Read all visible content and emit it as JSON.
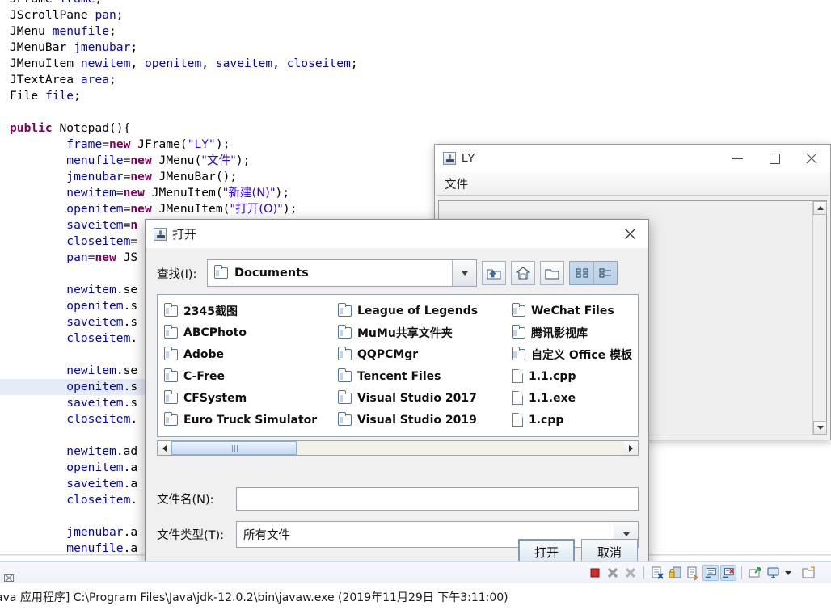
{
  "editor": {
    "code_lines": [
      {
        "hl": false,
        "tokens": [
          {
            "t": "JFrame ",
            "c": ""
          },
          {
            "t": "frame",
            "c": "fld"
          },
          {
            "t": ";",
            "c": ""
          }
        ]
      },
      {
        "hl": false,
        "tokens": [
          {
            "t": "JScrollPane ",
            "c": ""
          },
          {
            "t": "pan",
            "c": "fld"
          },
          {
            "t": ";",
            "c": ""
          }
        ]
      },
      {
        "hl": false,
        "tokens": [
          {
            "t": "JMenu ",
            "c": ""
          },
          {
            "t": "menufile",
            "c": "fld"
          },
          {
            "t": ";",
            "c": ""
          }
        ]
      },
      {
        "hl": false,
        "tokens": [
          {
            "t": "JMenuBar ",
            "c": ""
          },
          {
            "t": "jmenubar",
            "c": "fld"
          },
          {
            "t": ";",
            "c": ""
          }
        ]
      },
      {
        "hl": false,
        "tokens": [
          {
            "t": "JMenuItem ",
            "c": ""
          },
          {
            "t": "newitem",
            "c": "fld"
          },
          {
            "t": ", ",
            "c": ""
          },
          {
            "t": "openitem",
            "c": "fld"
          },
          {
            "t": ", ",
            "c": ""
          },
          {
            "t": "saveitem",
            "c": "fld"
          },
          {
            "t": ", ",
            "c": ""
          },
          {
            "t": "closeitem",
            "c": "fld"
          },
          {
            "t": ";",
            "c": ""
          }
        ]
      },
      {
        "hl": false,
        "tokens": [
          {
            "t": "JTextArea ",
            "c": ""
          },
          {
            "t": "area",
            "c": "fld"
          },
          {
            "t": ";",
            "c": ""
          }
        ]
      },
      {
        "hl": false,
        "tokens": [
          {
            "t": "File ",
            "c": ""
          },
          {
            "t": "file",
            "c": "fld"
          },
          {
            "t": ";",
            "c": ""
          }
        ]
      },
      {
        "hl": false,
        "tokens": []
      },
      {
        "hl": false,
        "tokens": [
          {
            "t": "public",
            "c": "kw"
          },
          {
            "t": " Notepad(){",
            "c": ""
          }
        ]
      },
      {
        "hl": false,
        "tokens": [
          {
            "t": "        ",
            "c": ""
          },
          {
            "t": "frame",
            "c": "fld"
          },
          {
            "t": "=",
            "c": ""
          },
          {
            "t": "new",
            "c": "kw"
          },
          {
            "t": " JFrame(",
            "c": ""
          },
          {
            "t": "\"LY\"",
            "c": "str"
          },
          {
            "t": ");",
            "c": ""
          }
        ]
      },
      {
        "hl": false,
        "tokens": [
          {
            "t": "        ",
            "c": ""
          },
          {
            "t": "menufile",
            "c": "fld"
          },
          {
            "t": "=",
            "c": ""
          },
          {
            "t": "new",
            "c": "kw"
          },
          {
            "t": " JMenu(",
            "c": ""
          },
          {
            "t": "\"文件\"",
            "c": "str"
          },
          {
            "t": ");",
            "c": ""
          }
        ]
      },
      {
        "hl": false,
        "tokens": [
          {
            "t": "        ",
            "c": ""
          },
          {
            "t": "jmenubar",
            "c": "fld"
          },
          {
            "t": "=",
            "c": ""
          },
          {
            "t": "new",
            "c": "kw"
          },
          {
            "t": " JMenuBar();",
            "c": ""
          }
        ]
      },
      {
        "hl": false,
        "tokens": [
          {
            "t": "        ",
            "c": ""
          },
          {
            "t": "newitem",
            "c": "fld"
          },
          {
            "t": "=",
            "c": ""
          },
          {
            "t": "new",
            "c": "kw"
          },
          {
            "t": " JMenuItem(",
            "c": ""
          },
          {
            "t": "\"新建(N)\"",
            "c": "str"
          },
          {
            "t": ");",
            "c": ""
          }
        ]
      },
      {
        "hl": false,
        "tokens": [
          {
            "t": "        ",
            "c": ""
          },
          {
            "t": "openitem",
            "c": "fld"
          },
          {
            "t": "=",
            "c": ""
          },
          {
            "t": "new",
            "c": "kw"
          },
          {
            "t": " JMenuItem(",
            "c": ""
          },
          {
            "t": "\"打开(O)\"",
            "c": "str"
          },
          {
            "t": ");",
            "c": ""
          }
        ]
      },
      {
        "hl": false,
        "tokens": [
          {
            "t": "        ",
            "c": ""
          },
          {
            "t": "saveitem",
            "c": "fld"
          },
          {
            "t": "=",
            "c": ""
          },
          {
            "t": "n",
            "c": "kw"
          }
        ]
      },
      {
        "hl": false,
        "tokens": [
          {
            "t": "        ",
            "c": ""
          },
          {
            "t": "closeitem",
            "c": "fld"
          },
          {
            "t": "=",
            "c": ""
          }
        ]
      },
      {
        "hl": false,
        "tokens": [
          {
            "t": "        ",
            "c": ""
          },
          {
            "t": "pan",
            "c": "fld"
          },
          {
            "t": "=",
            "c": ""
          },
          {
            "t": "new",
            "c": "kw"
          },
          {
            "t": " JS",
            "c": ""
          }
        ]
      },
      {
        "hl": false,
        "tokens": []
      },
      {
        "hl": false,
        "tokens": [
          {
            "t": "        ",
            "c": ""
          },
          {
            "t": "newitem",
            "c": "fld"
          },
          {
            "t": ".se",
            "c": ""
          }
        ]
      },
      {
        "hl": false,
        "tokens": [
          {
            "t": "        ",
            "c": ""
          },
          {
            "t": "openitem",
            "c": "fld"
          },
          {
            "t": ".s",
            "c": ""
          }
        ]
      },
      {
        "hl": false,
        "tokens": [
          {
            "t": "        ",
            "c": ""
          },
          {
            "t": "saveitem",
            "c": "fld"
          },
          {
            "t": ".s",
            "c": ""
          }
        ]
      },
      {
        "hl": false,
        "tokens": [
          {
            "t": "        ",
            "c": ""
          },
          {
            "t": "closeitem",
            "c": "fld"
          },
          {
            "t": ".",
            "c": ""
          }
        ]
      },
      {
        "hl": false,
        "tokens": []
      },
      {
        "hl": false,
        "tokens": [
          {
            "t": "        ",
            "c": ""
          },
          {
            "t": "newitem",
            "c": "fld"
          },
          {
            "t": ".se",
            "c": ""
          }
        ]
      },
      {
        "hl": true,
        "tokens": [
          {
            "t": "        ",
            "c": ""
          },
          {
            "t": "openitem",
            "c": "fld"
          },
          {
            "t": ".s",
            "c": ""
          }
        ]
      },
      {
        "hl": false,
        "tokens": [
          {
            "t": "        ",
            "c": ""
          },
          {
            "t": "saveitem",
            "c": "fld"
          },
          {
            "t": ".s",
            "c": ""
          }
        ]
      },
      {
        "hl": false,
        "tokens": [
          {
            "t": "        ",
            "c": ""
          },
          {
            "t": "closeitem",
            "c": "fld"
          },
          {
            "t": ".",
            "c": ""
          }
        ]
      },
      {
        "hl": false,
        "tokens": []
      },
      {
        "hl": false,
        "tokens": [
          {
            "t": "        ",
            "c": ""
          },
          {
            "t": "newitem",
            "c": "fld"
          },
          {
            "t": ".ad",
            "c": ""
          }
        ]
      },
      {
        "hl": false,
        "tokens": [
          {
            "t": "        ",
            "c": ""
          },
          {
            "t": "openitem",
            "c": "fld"
          },
          {
            "t": ".a",
            "c": ""
          }
        ]
      },
      {
        "hl": false,
        "tokens": [
          {
            "t": "        ",
            "c": ""
          },
          {
            "t": "saveitem",
            "c": "fld"
          },
          {
            "t": ".a",
            "c": ""
          }
        ]
      },
      {
        "hl": false,
        "tokens": [
          {
            "t": "        ",
            "c": ""
          },
          {
            "t": "closeitem",
            "c": "fld"
          },
          {
            "t": ".",
            "c": ""
          }
        ]
      },
      {
        "hl": false,
        "tokens": []
      },
      {
        "hl": false,
        "tokens": [
          {
            "t": "        ",
            "c": ""
          },
          {
            "t": "jmenubar",
            "c": "fld"
          },
          {
            "t": ".a",
            "c": ""
          }
        ]
      },
      {
        "hl": false,
        "tokens": [
          {
            "t": "        ",
            "c": ""
          },
          {
            "t": "menufile",
            "c": "fld"
          },
          {
            "t": ".a",
            "c": ""
          }
        ]
      }
    ],
    "right_fragment": ")"
  },
  "ly_window": {
    "title": "LY",
    "icon": "java-cup-icon",
    "menu": [
      "文件"
    ],
    "window_buttons": [
      {
        "name": "minimize",
        "glyph": "—"
      },
      {
        "name": "maximize",
        "glyph": "□"
      },
      {
        "name": "close",
        "glyph": "✕"
      }
    ]
  },
  "dialog": {
    "title": "打开",
    "icon": "java-cup-icon",
    "close_glyph": "✕",
    "look_in_label": "查找(I):",
    "look_in_value": "Documents",
    "toolbar": [
      {
        "name": "up-one-level-icon",
        "label": "向上一级"
      },
      {
        "name": "home-icon",
        "label": "主目录"
      },
      {
        "name": "new-folder-icon",
        "label": "创建新文件夹"
      },
      {
        "name": "list-view-icon",
        "label": "列表",
        "selected": true
      },
      {
        "name": "details-view-icon",
        "label": "详细信息",
        "selected": false
      }
    ],
    "files": {
      "col1": [
        {
          "name": "2345截图",
          "type": "folder"
        },
        {
          "name": "ABCPhoto",
          "type": "folder"
        },
        {
          "name": "Adobe",
          "type": "folder"
        },
        {
          "name": "C-Free",
          "type": "folder"
        },
        {
          "name": "CFSystem",
          "type": "folder"
        },
        {
          "name": "Euro Truck Simulator",
          "type": "folder"
        }
      ],
      "col2": [
        {
          "name": "League of Legends",
          "type": "folder"
        },
        {
          "name": "MuMu共享文件夹",
          "type": "folder"
        },
        {
          "name": "QQPCMgr",
          "type": "folder"
        },
        {
          "name": "Tencent Files",
          "type": "folder"
        },
        {
          "name": "Visual Studio 2017",
          "type": "folder"
        },
        {
          "name": "Visual Studio 2019",
          "type": "folder"
        }
      ],
      "col3": [
        {
          "name": "WeChat Files",
          "type": "folder"
        },
        {
          "name": "腾讯影视库",
          "type": "folder"
        },
        {
          "name": "自定义 Office 模板",
          "type": "folder"
        },
        {
          "name": "1.1.cpp",
          "type": "file"
        },
        {
          "name": "1.1.exe",
          "type": "file"
        },
        {
          "name": "1.cpp",
          "type": "file"
        }
      ]
    },
    "file_name_label": "文件名(N):",
    "file_name_value": "",
    "file_type_label": "文件类型(T):",
    "file_type_value": "所有文件",
    "open_button": "打开",
    "cancel_button": "取消"
  },
  "console": {
    "status_text": "ava 应用程序] C:\\Program Files\\Java\\jdk-12.0.2\\bin\\javaw.exe  (2019年11月29日 下午3:11:00)",
    "toolbar": [
      {
        "name": "terminate-icon",
        "selected": false
      },
      {
        "name": "remove-launch-icon",
        "selected": false
      },
      {
        "name": "remove-all-terminated-icon",
        "selected": false
      },
      {
        "name": "clear-console-icon",
        "selected": false
      },
      {
        "name": "scroll-lock-icon",
        "selected": false
      },
      {
        "name": "word-wrap-icon",
        "selected": false
      },
      {
        "name": "show-console-on-output-icon",
        "selected": true
      },
      {
        "name": "show-console-on-error-icon",
        "selected": true
      },
      {
        "name": "pin-console-icon",
        "selected": false
      },
      {
        "name": "display-selected-console-icon",
        "selected": false
      },
      {
        "name": "console-dropdown-icon",
        "selected": false
      },
      {
        "name": "open-console-icon",
        "selected": false
      }
    ],
    "tab_close_glyph": "⌧"
  },
  "colors": {
    "keyword": "#7f0055",
    "field": "#0000c0",
    "string": "#2a00ff",
    "highlight_line": "#e6ecf7",
    "dialog_bg": "#f0f0f0",
    "selected_toolbar": "#cadcee"
  }
}
